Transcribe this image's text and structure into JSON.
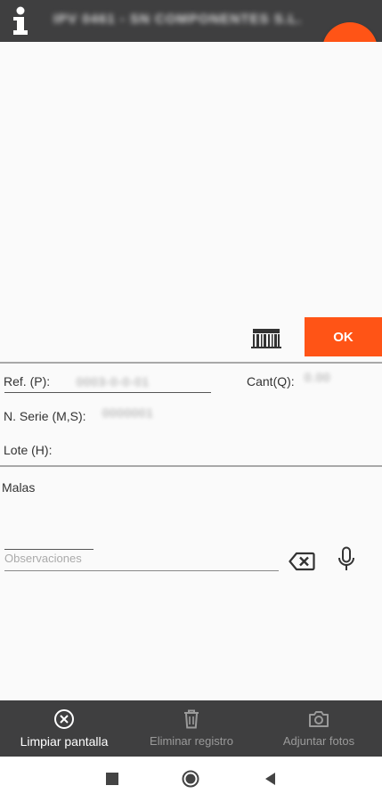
{
  "header": {
    "title": "IPV 0461 - SN COMPONENTES S.L."
  },
  "scan": {
    "ok_label": "OK"
  },
  "details": {
    "ref_label": "Ref. (P):",
    "ref_value": "0003-0-0-01",
    "cant_label": "Cant(Q):",
    "cant_value": "0.00",
    "serie_label": "N. Serie (M,S):",
    "serie_value": "0000001",
    "lote_label": "Lote (H):"
  },
  "malas": {
    "label": "Malas"
  },
  "observaciones": {
    "placeholder": "Observaciones"
  },
  "bottom_nav": {
    "limpiar": "Limpiar pantalla",
    "eliminar": "Eliminar registro",
    "adjuntar": "Adjuntar fotos"
  },
  "colors": {
    "accent": "#ff5416",
    "bar": "#3f3f40"
  }
}
